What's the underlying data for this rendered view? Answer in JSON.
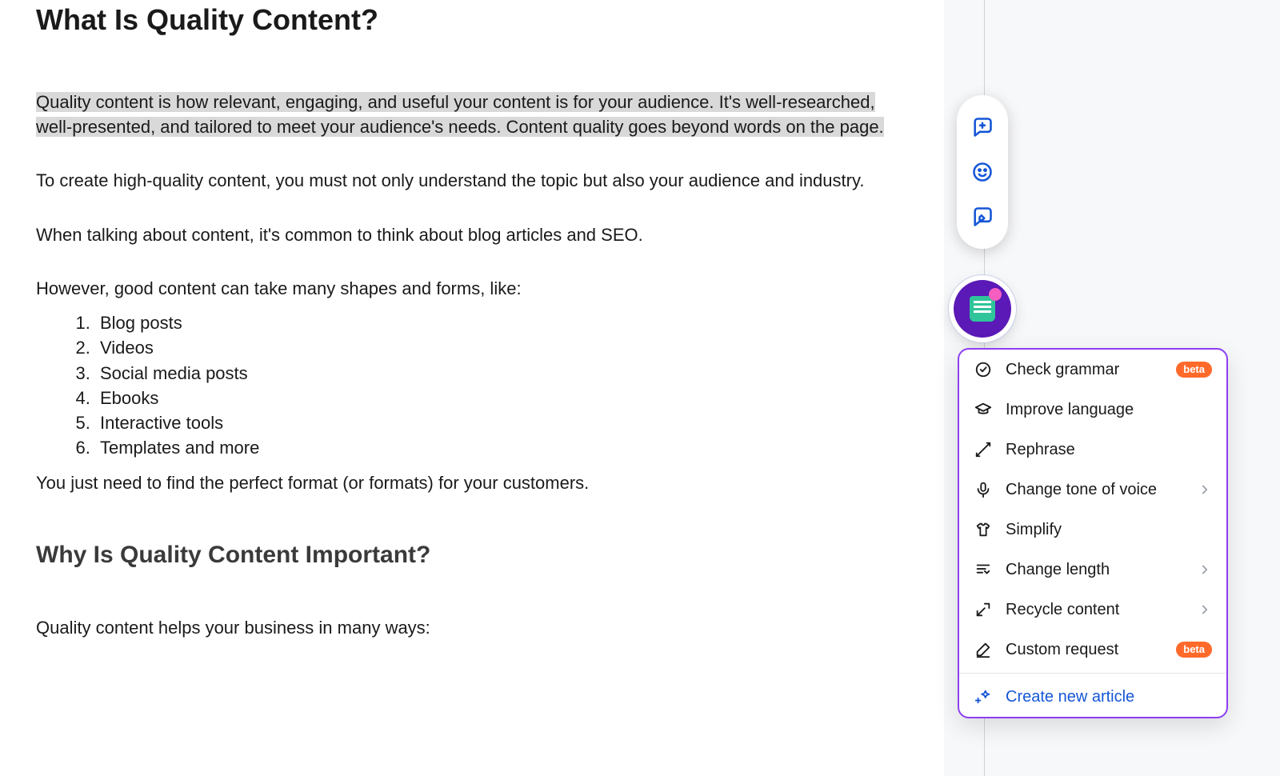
{
  "article": {
    "heading1": "What Is Quality Content?",
    "para_highlighted": "Quality content is how relevant, engaging, and useful your content is for your audience. It's well-researched, well-presented, and tailored to meet your audience's needs. Content quality goes beyond words on the page.",
    "para2": "To create high-quality content, you must not only understand the topic but also your audience and industry.",
    "para3": "When talking about content, it's common to think about blog articles and SEO.",
    "para4": "However, good content can take many shapes and forms, like:",
    "list_items": [
      "Blog posts",
      "Videos",
      "Social media posts",
      "Ebooks",
      "Interactive tools",
      "Templates and more"
    ],
    "para5": "You just need to find the perfect format (or formats) for your customers.",
    "heading2": "Why Is Quality Content Important?",
    "para6": "Quality content helps your business in many ways:"
  },
  "floating_pill": {
    "icons": [
      "add-comment",
      "emoji",
      "suggest-edit"
    ]
  },
  "ai_menu": {
    "items": [
      {
        "icon": "check-circle",
        "label": "Check grammar",
        "badge": "beta",
        "submenu": false
      },
      {
        "icon": "graduation-cap",
        "label": "Improve language",
        "badge": null,
        "submenu": false
      },
      {
        "icon": "shuffle",
        "label": "Rephrase",
        "badge": null,
        "submenu": false
      },
      {
        "icon": "mic",
        "label": "Change tone of voice",
        "badge": null,
        "submenu": true
      },
      {
        "icon": "tshirt",
        "label": "Simplify",
        "badge": null,
        "submenu": false
      },
      {
        "icon": "text-resize",
        "label": "Change length",
        "badge": null,
        "submenu": true
      },
      {
        "icon": "recycle-arrow",
        "label": "Recycle content",
        "badge": null,
        "submenu": true
      },
      {
        "icon": "pen-custom",
        "label": "Custom request",
        "badge": "beta",
        "submenu": false
      }
    ],
    "accent_item": {
      "icon": "sparkle-plus",
      "label": "Create new article"
    }
  },
  "colors": {
    "link": "#1556d6",
    "accent_border": "#8c3ff2",
    "badge_bg": "#ff6a2b"
  }
}
